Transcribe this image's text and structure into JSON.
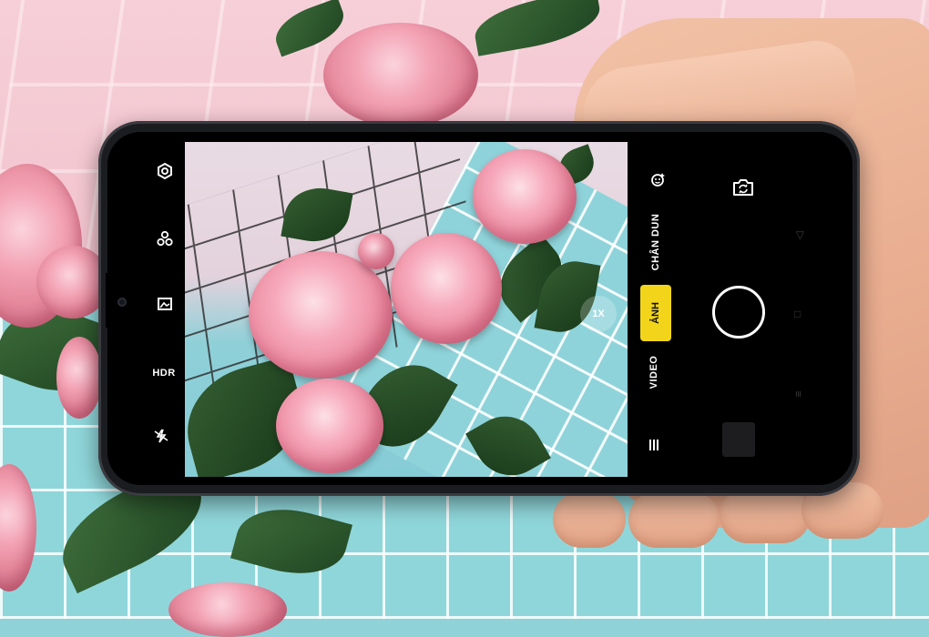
{
  "camera": {
    "left_toolbar": {
      "settings_icon": "gear-icon",
      "filter_icon": "filters-icon",
      "aspect_icon": "photo-ratio-icon",
      "hdr_label": "HDR",
      "flash_icon": "flash-off-icon"
    },
    "viewfinder": {
      "zoom_label": "1X"
    },
    "right_panel": {
      "beauty_icon": "beauty-face-icon",
      "switch_camera_icon": "switch-camera-icon",
      "modes": {
        "portrait": "CHÂN DUN",
        "photo": "ẢNH",
        "video": "VIDEO"
      },
      "active_mode": "ẢNH",
      "menu_icon": "menu-icon",
      "shutter_icon": "shutter-button",
      "gallery_icon": "gallery-thumbnail"
    },
    "nav_ghost": {
      "back": "◁",
      "home": "□",
      "recents": "≡"
    }
  },
  "colors": {
    "accent_yellow": "#f2d51b",
    "background_teal": "#8fd3da",
    "background_pink": "#f3c6d0",
    "phone_body": "#1b1c20"
  }
}
